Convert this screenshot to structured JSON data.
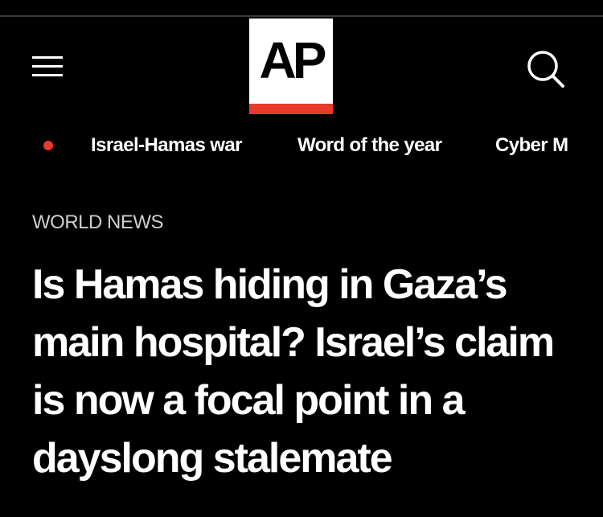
{
  "header": {
    "menu_icon": "hamburger-menu-icon",
    "logo_text": "AP",
    "search_icon": "search-icon"
  },
  "nav": {
    "live_indicator_color": "#e8392d",
    "items": [
      {
        "label": "Israel-Hamas war"
      },
      {
        "label": "Word of the year"
      },
      {
        "label": "Cyber M"
      }
    ]
  },
  "article": {
    "section": "WORLD NEWS",
    "headline": "Is Hamas hiding in Gaza’s main hospital? Israel’s claim is now a focal point in a dayslong stalemate"
  },
  "colors": {
    "background": "#000000",
    "text": "#ffffff",
    "accent": "#e8392d"
  }
}
